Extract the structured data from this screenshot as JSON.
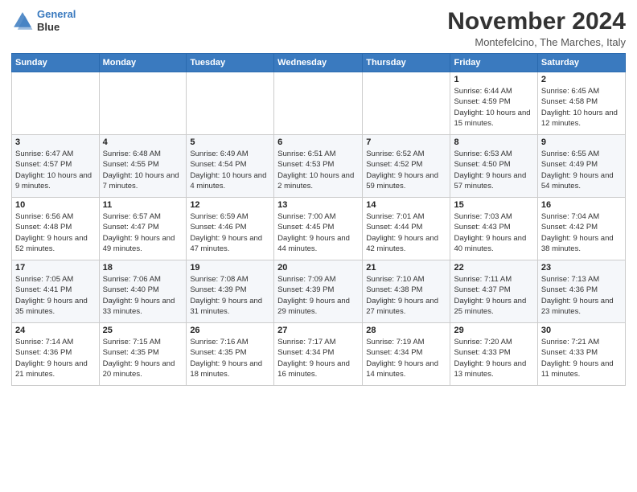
{
  "logo": {
    "line1": "General",
    "line2": "Blue"
  },
  "title": "November 2024",
  "subtitle": "Montefelcino, The Marches, Italy",
  "days_header": [
    "Sunday",
    "Monday",
    "Tuesday",
    "Wednesday",
    "Thursday",
    "Friday",
    "Saturday"
  ],
  "weeks": [
    [
      {
        "num": "",
        "info": ""
      },
      {
        "num": "",
        "info": ""
      },
      {
        "num": "",
        "info": ""
      },
      {
        "num": "",
        "info": ""
      },
      {
        "num": "",
        "info": ""
      },
      {
        "num": "1",
        "info": "Sunrise: 6:44 AM\nSunset: 4:59 PM\nDaylight: 10 hours and 15 minutes."
      },
      {
        "num": "2",
        "info": "Sunrise: 6:45 AM\nSunset: 4:58 PM\nDaylight: 10 hours and 12 minutes."
      }
    ],
    [
      {
        "num": "3",
        "info": "Sunrise: 6:47 AM\nSunset: 4:57 PM\nDaylight: 10 hours and 9 minutes."
      },
      {
        "num": "4",
        "info": "Sunrise: 6:48 AM\nSunset: 4:55 PM\nDaylight: 10 hours and 7 minutes."
      },
      {
        "num": "5",
        "info": "Sunrise: 6:49 AM\nSunset: 4:54 PM\nDaylight: 10 hours and 4 minutes."
      },
      {
        "num": "6",
        "info": "Sunrise: 6:51 AM\nSunset: 4:53 PM\nDaylight: 10 hours and 2 minutes."
      },
      {
        "num": "7",
        "info": "Sunrise: 6:52 AM\nSunset: 4:52 PM\nDaylight: 9 hours and 59 minutes."
      },
      {
        "num": "8",
        "info": "Sunrise: 6:53 AM\nSunset: 4:50 PM\nDaylight: 9 hours and 57 minutes."
      },
      {
        "num": "9",
        "info": "Sunrise: 6:55 AM\nSunset: 4:49 PM\nDaylight: 9 hours and 54 minutes."
      }
    ],
    [
      {
        "num": "10",
        "info": "Sunrise: 6:56 AM\nSunset: 4:48 PM\nDaylight: 9 hours and 52 minutes."
      },
      {
        "num": "11",
        "info": "Sunrise: 6:57 AM\nSunset: 4:47 PM\nDaylight: 9 hours and 49 minutes."
      },
      {
        "num": "12",
        "info": "Sunrise: 6:59 AM\nSunset: 4:46 PM\nDaylight: 9 hours and 47 minutes."
      },
      {
        "num": "13",
        "info": "Sunrise: 7:00 AM\nSunset: 4:45 PM\nDaylight: 9 hours and 44 minutes."
      },
      {
        "num": "14",
        "info": "Sunrise: 7:01 AM\nSunset: 4:44 PM\nDaylight: 9 hours and 42 minutes."
      },
      {
        "num": "15",
        "info": "Sunrise: 7:03 AM\nSunset: 4:43 PM\nDaylight: 9 hours and 40 minutes."
      },
      {
        "num": "16",
        "info": "Sunrise: 7:04 AM\nSunset: 4:42 PM\nDaylight: 9 hours and 38 minutes."
      }
    ],
    [
      {
        "num": "17",
        "info": "Sunrise: 7:05 AM\nSunset: 4:41 PM\nDaylight: 9 hours and 35 minutes."
      },
      {
        "num": "18",
        "info": "Sunrise: 7:06 AM\nSunset: 4:40 PM\nDaylight: 9 hours and 33 minutes."
      },
      {
        "num": "19",
        "info": "Sunrise: 7:08 AM\nSunset: 4:39 PM\nDaylight: 9 hours and 31 minutes."
      },
      {
        "num": "20",
        "info": "Sunrise: 7:09 AM\nSunset: 4:39 PM\nDaylight: 9 hours and 29 minutes."
      },
      {
        "num": "21",
        "info": "Sunrise: 7:10 AM\nSunset: 4:38 PM\nDaylight: 9 hours and 27 minutes."
      },
      {
        "num": "22",
        "info": "Sunrise: 7:11 AM\nSunset: 4:37 PM\nDaylight: 9 hours and 25 minutes."
      },
      {
        "num": "23",
        "info": "Sunrise: 7:13 AM\nSunset: 4:36 PM\nDaylight: 9 hours and 23 minutes."
      }
    ],
    [
      {
        "num": "24",
        "info": "Sunrise: 7:14 AM\nSunset: 4:36 PM\nDaylight: 9 hours and 21 minutes."
      },
      {
        "num": "25",
        "info": "Sunrise: 7:15 AM\nSunset: 4:35 PM\nDaylight: 9 hours and 20 minutes."
      },
      {
        "num": "26",
        "info": "Sunrise: 7:16 AM\nSunset: 4:35 PM\nDaylight: 9 hours and 18 minutes."
      },
      {
        "num": "27",
        "info": "Sunrise: 7:17 AM\nSunset: 4:34 PM\nDaylight: 9 hours and 16 minutes."
      },
      {
        "num": "28",
        "info": "Sunrise: 7:19 AM\nSunset: 4:34 PM\nDaylight: 9 hours and 14 minutes."
      },
      {
        "num": "29",
        "info": "Sunrise: 7:20 AM\nSunset: 4:33 PM\nDaylight: 9 hours and 13 minutes."
      },
      {
        "num": "30",
        "info": "Sunrise: 7:21 AM\nSunset: 4:33 PM\nDaylight: 9 hours and 11 minutes."
      }
    ]
  ]
}
